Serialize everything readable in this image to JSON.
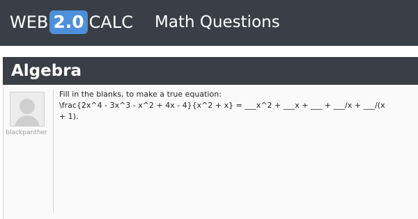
{
  "header": {
    "logo_web": "WEB",
    "logo_version": "2.0",
    "logo_calc": "CALC",
    "tagline": "Math Questions",
    "bg_color": "#3a3f47",
    "badge_color": "#4d8fd9"
  },
  "category": {
    "title": "Algebra"
  },
  "question": {
    "author": "blackpanther",
    "avatar_icon": "default-user-avatar-icon",
    "lines": [
      "Fill in the blanks, to make a true equation:",
      "\\frac{2x^4 - 3x^3 - x^2 + 4x - 4}{x^2 + x} = ___x^2 + ___x + ___ + ___/x + ___/(x",
      "+ 1)."
    ]
  }
}
